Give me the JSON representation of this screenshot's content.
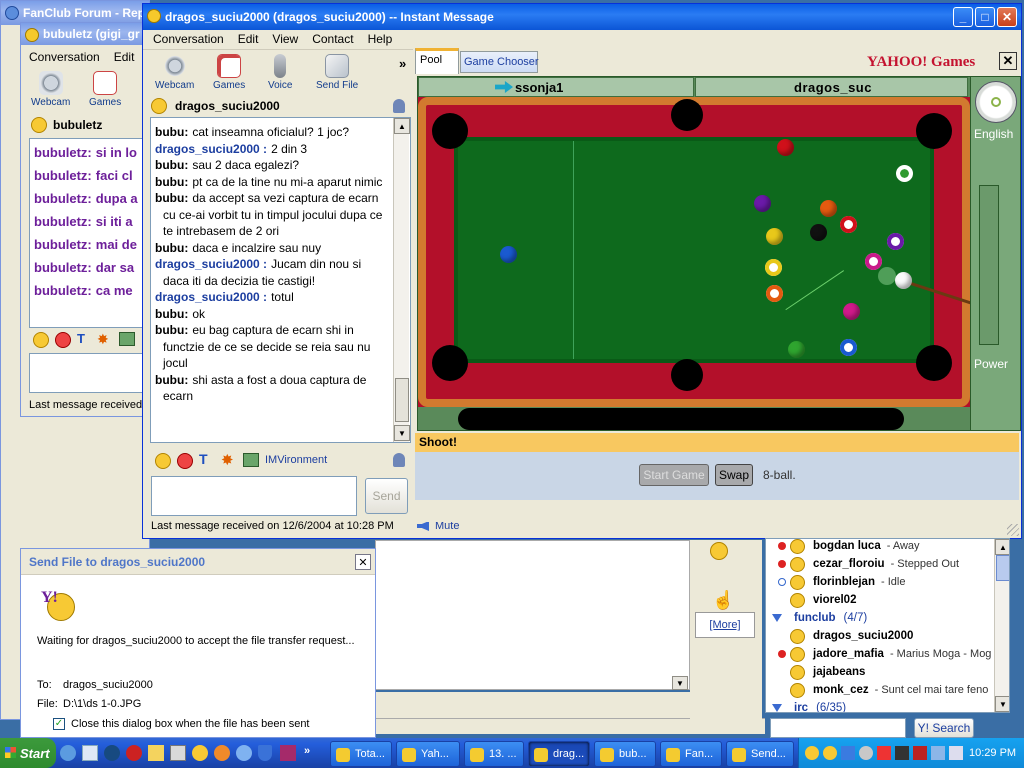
{
  "bg_window": {
    "title": "FanClub Forum - Rep"
  },
  "bubuletz_window": {
    "title": "bubuletz (gigi_gr",
    "menu": [
      "Conversation",
      "Edit"
    ],
    "tool_labels": [
      "Webcam",
      "Games"
    ],
    "contact": "bubuletz",
    "lines": [
      {
        "sender": "bubuletz:",
        "text": "si in lo"
      },
      {
        "sender": "bubuletz:",
        "text": "faci cl"
      },
      {
        "sender": "bubuletz:",
        "text": "dupa a"
      },
      {
        "sender": "bubuletz:",
        "text": "si iti a"
      },
      {
        "sender": "bubuletz:",
        "text": "mai de"
      },
      {
        "sender": "bubuletz:",
        "text": "dar sa"
      },
      {
        "sender": "bubuletz:",
        "text": "ca me"
      }
    ],
    "status": "Last message received"
  },
  "im_window": {
    "title": "dragos_suciu2000  (dragos_suciu2000) -- Instant Message",
    "menu": [
      "Conversation",
      "Edit",
      "View",
      "Contact",
      "Help"
    ],
    "toolbar": [
      {
        "label": "Webcam",
        "icon": "webcam-icon"
      },
      {
        "label": "Games",
        "icon": "dice-icon"
      },
      {
        "label": "Voice",
        "icon": "microphone-icon"
      },
      {
        "label": "Send File",
        "icon": "send-file-icon"
      }
    ],
    "more_chevron": "»",
    "contact_name": "dragos_suciu2000",
    "messages": [
      {
        "sender": "bubu:",
        "me": false,
        "text": "cat inseamna oficialul? 1 joc?"
      },
      {
        "sender": "dragos_suciu2000 :",
        "me": true,
        "text": "2 din 3"
      },
      {
        "sender": "bubu:",
        "me": false,
        "text": "sau 2 daca egalezi?"
      },
      {
        "sender": "bubu:",
        "me": false,
        "text": "pt ca de la tine nu mi-a aparut nimic"
      },
      {
        "sender": "bubu:",
        "me": false,
        "text": "da accept sa vezi captura de ecarn cu ce-ai vorbit tu in timpul jocului dupa ce te intrebasem de 2 ori"
      },
      {
        "sender": "bubu:",
        "me": false,
        "text": "daca e incalzire sau nuy"
      },
      {
        "sender": "dragos_suciu2000 :",
        "me": true,
        "text": "Jucam din nou si daca iti da decizia tie castigi!"
      },
      {
        "sender": "dragos_suciu2000 :",
        "me": true,
        "text": "totul"
      },
      {
        "sender": "bubu:",
        "me": false,
        "text": "ok"
      },
      {
        "sender": "bubu:",
        "me": false,
        "text": "eu bag captura de ecarn shi in functzie de ce se decide se reia sau nu jocul"
      },
      {
        "sender": "bubu:",
        "me": false,
        "text": "shi asta a fost a doua captura de ecarn"
      }
    ],
    "imvironment_label": "IMVironment",
    "send_label": "Send",
    "status": "Last message received on 12/6/2004 at 10:28 PM",
    "mute_label": "Mute"
  },
  "game": {
    "tabs": [
      "Pool",
      "Game Chooser"
    ],
    "brand": "YAHOO! Games",
    "player1": "ssonja1",
    "player2": "dragos_suc",
    "language_label": "English",
    "power_label": "Power",
    "message": "Shoot!",
    "start_game_label": "Start Game",
    "swap_label": "Swap",
    "mode": "8-ball."
  },
  "buddy_list": {
    "buddies": [
      {
        "name": "bogdan luca",
        "status": "- Away",
        "mark": "away"
      },
      {
        "name": "cezar_floroiu",
        "status": "- Stepped Out",
        "mark": "away"
      },
      {
        "name": "florinblejan",
        "status": "- Idle",
        "mark": "idle"
      },
      {
        "name": "viorel02",
        "status": "",
        "mark": ""
      }
    ],
    "group": {
      "name": "funclub",
      "count": "(4/7)"
    },
    "group_buddies": [
      {
        "name": "dragos_suciu2000",
        "status": "",
        "mark": ""
      },
      {
        "name": "jadore_mafia",
        "status": "- Marius Moga - Mog",
        "mark": "away"
      },
      {
        "name": "jajabeans",
        "status": "",
        "mark": ""
      },
      {
        "name": "monk_cez",
        "status": "- Sunt cel mai tare feno",
        "mark": ""
      }
    ],
    "group2": {
      "name": "irc",
      "count": "(6/35)"
    },
    "search_button": "Y! Search",
    "more_link": "[More]"
  },
  "send_file": {
    "title": "Send File to dragos_suciu2000",
    "waiting": "Waiting for dragos_suciu2000 to accept the file transfer request...",
    "to_label": "To:",
    "to_value": "dragos_suciu2000",
    "file_label": "File:",
    "file_value": "D:\\1\\ds 1-0.JPG",
    "close_checkbox_label": "Close this dialog box when the file has been sent",
    "close_checked": true
  },
  "taskbar": {
    "start": "Start",
    "items": [
      {
        "label": "Tota...",
        "active": false
      },
      {
        "label": "Yah...",
        "active": false
      },
      {
        "label": "13. ...",
        "active": false
      },
      {
        "label": "drag...",
        "active": true
      },
      {
        "label": "bub...",
        "active": false
      },
      {
        "label": "Fan...",
        "active": false
      },
      {
        "label": "Send...",
        "active": false
      }
    ],
    "clock": "10:29 PM"
  }
}
